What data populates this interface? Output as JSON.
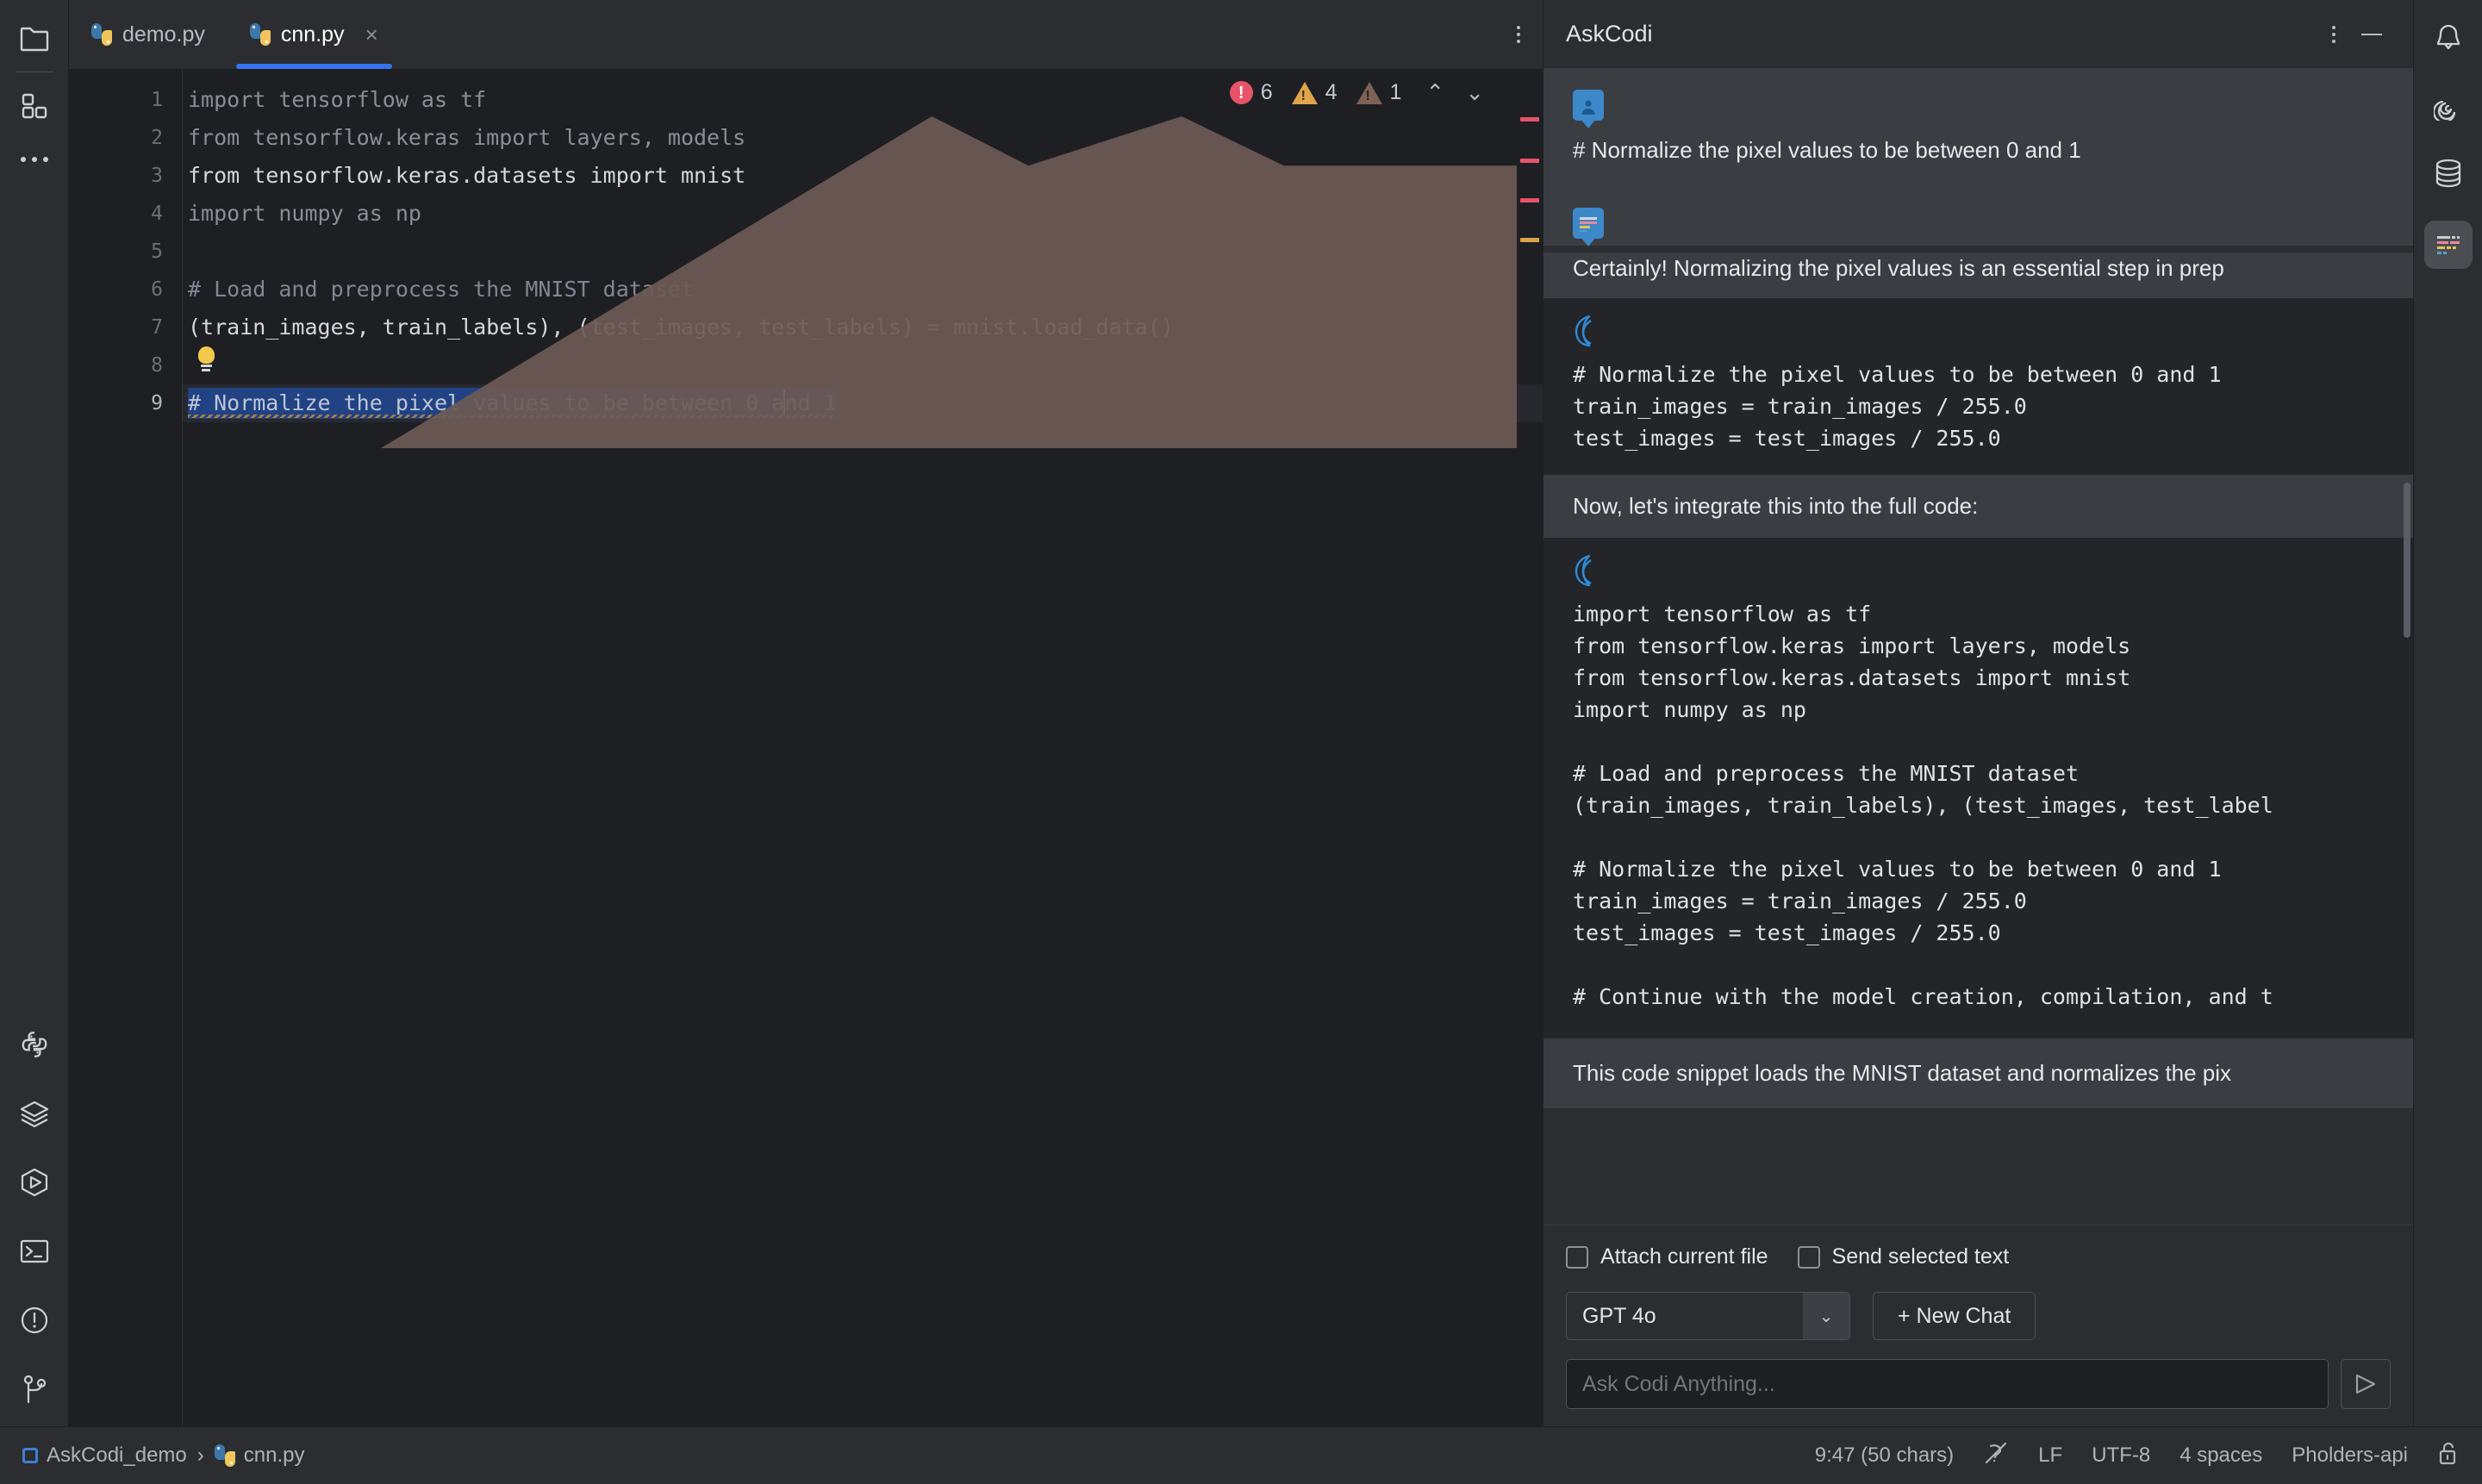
{
  "left_toolbar": {
    "items": [
      {
        "name": "project-folder-icon",
        "label": "Project"
      },
      {
        "name": "plugins-icon",
        "label": "Plugins"
      },
      {
        "name": "more-options-icon",
        "label": "More"
      }
    ],
    "bottom_items": [
      {
        "name": "python-packages-icon",
        "label": "Python Packages"
      },
      {
        "name": "database-layers-icon",
        "label": "Layers"
      },
      {
        "name": "run-icon",
        "label": "Run"
      },
      {
        "name": "terminal-icon",
        "label": "Terminal"
      },
      {
        "name": "problems-icon",
        "label": "Problems"
      },
      {
        "name": "version-control-icon",
        "label": "Version Control"
      }
    ]
  },
  "editor": {
    "tabs": [
      {
        "label": "demo.py",
        "active": false,
        "closable": false
      },
      {
        "label": "cnn.py",
        "active": true,
        "closable": true,
        "close_label": "×"
      }
    ],
    "tab_menu_label": "More tab actions",
    "inspections": {
      "error_count": "6",
      "warning_count": "4",
      "weak_warning_count": "1",
      "prev_label": "⌃",
      "next_label": "⌄",
      "error_color": "#e8536a",
      "warning_color": "#e0a44a",
      "weak_color": "#7d6256"
    },
    "lines": [
      {
        "num": "1",
        "text": "import tensorflow as tf",
        "style": "dim"
      },
      {
        "num": "2",
        "text": "from tensorflow.keras import layers, models",
        "style": "dim"
      },
      {
        "num": "3",
        "text": "from tensorflow.keras.datasets import mnist",
        "style": "bright"
      },
      {
        "num": "4",
        "text": "import numpy as np",
        "style": "dim"
      },
      {
        "num": "5",
        "text": "",
        "style": "dim"
      },
      {
        "num": "6",
        "text": "# Load and preprocess the MNIST dataset",
        "style": "cmt"
      },
      {
        "num": "7",
        "text": "(train_images, train_labels), (test_images, test_labels) = mnist.load_data()",
        "style": "bright"
      },
      {
        "num": "8",
        "text": "",
        "style": "dim"
      },
      {
        "num": "9",
        "text": "# Normalize the pixel values to be between 0 and 1",
        "style": "selected"
      }
    ],
    "selected_line_prefix": "# Normalize the pixel values to be between 0 a",
    "selected_line_suffix": "nd 1",
    "bulb_name": "intention-bulb-icon"
  },
  "ask_codi": {
    "title": "AskCodi",
    "more_label": "More options",
    "minimize_label": "Minimize",
    "messages": [
      {
        "role": "user",
        "avatar": "user-avatar-icon",
        "text": "# Normalize the pixel values to be between 0 and 1"
      },
      {
        "role": "assistant",
        "avatar": "codi-assistant-avatar-icon",
        "text": "Certainly! Normalizing the pixel values is an essential step in prep"
      }
    ],
    "code_block_1": {
      "logo_name": "codi-logo-icon",
      "code": "# Normalize the pixel values to be between 0 and 1\ntrain_images = train_images / 255.0\ntest_images = test_images / 255.0"
    },
    "mid_text": "Now, let's integrate this into the full code:",
    "code_block_2": {
      "logo_name": "codi-logo-icon",
      "code": "import tensorflow as tf\nfrom tensorflow.keras import layers, models\nfrom tensorflow.keras.datasets import mnist\nimport numpy as np\n\n# Load and preprocess the MNIST dataset\n(train_images, train_labels), (test_images, test_label\n\n# Normalize the pixel values to be between 0 and 1\ntrain_images = train_images / 255.0\ntest_images = test_images / 255.0\n\n# Continue with the model creation, compilation, and t"
    },
    "closing_text": "This code snippet loads the MNIST dataset and normalizes the pix",
    "controls": {
      "attach_file_label": "Attach current file",
      "attach_file_checked": false,
      "send_selected_label": "Send selected text",
      "send_selected_checked": false,
      "model_value": "GPT 4o",
      "model_caret": "⌄",
      "new_chat_label": "+ New Chat",
      "input_placeholder": "Ask Codi Anything...",
      "input_value": "",
      "send_label": "Send"
    }
  },
  "right_toolbar": {
    "items": [
      {
        "name": "notifications-bell-icon",
        "label": "Notifications"
      },
      {
        "name": "spiral-icon",
        "label": "AI Assistant"
      },
      {
        "name": "database-icon",
        "label": "Database"
      },
      {
        "name": "askcodi-panel-icon",
        "label": "AskCodi"
      }
    ]
  },
  "status_bar": {
    "breadcrumb": [
      {
        "name": "project-crumb",
        "label": "AskCodi_demo"
      },
      {
        "name": "file-crumb",
        "label": "cnn.py"
      }
    ],
    "separator": "›",
    "caret_position": "9:47 (50 chars)",
    "inspection_icon": "inspections-off-icon",
    "line_separator": "LF",
    "encoding": "UTF-8",
    "indent": "4 spaces",
    "branch": "Pholders-api",
    "lock_icon": "read-write-lock-icon"
  }
}
